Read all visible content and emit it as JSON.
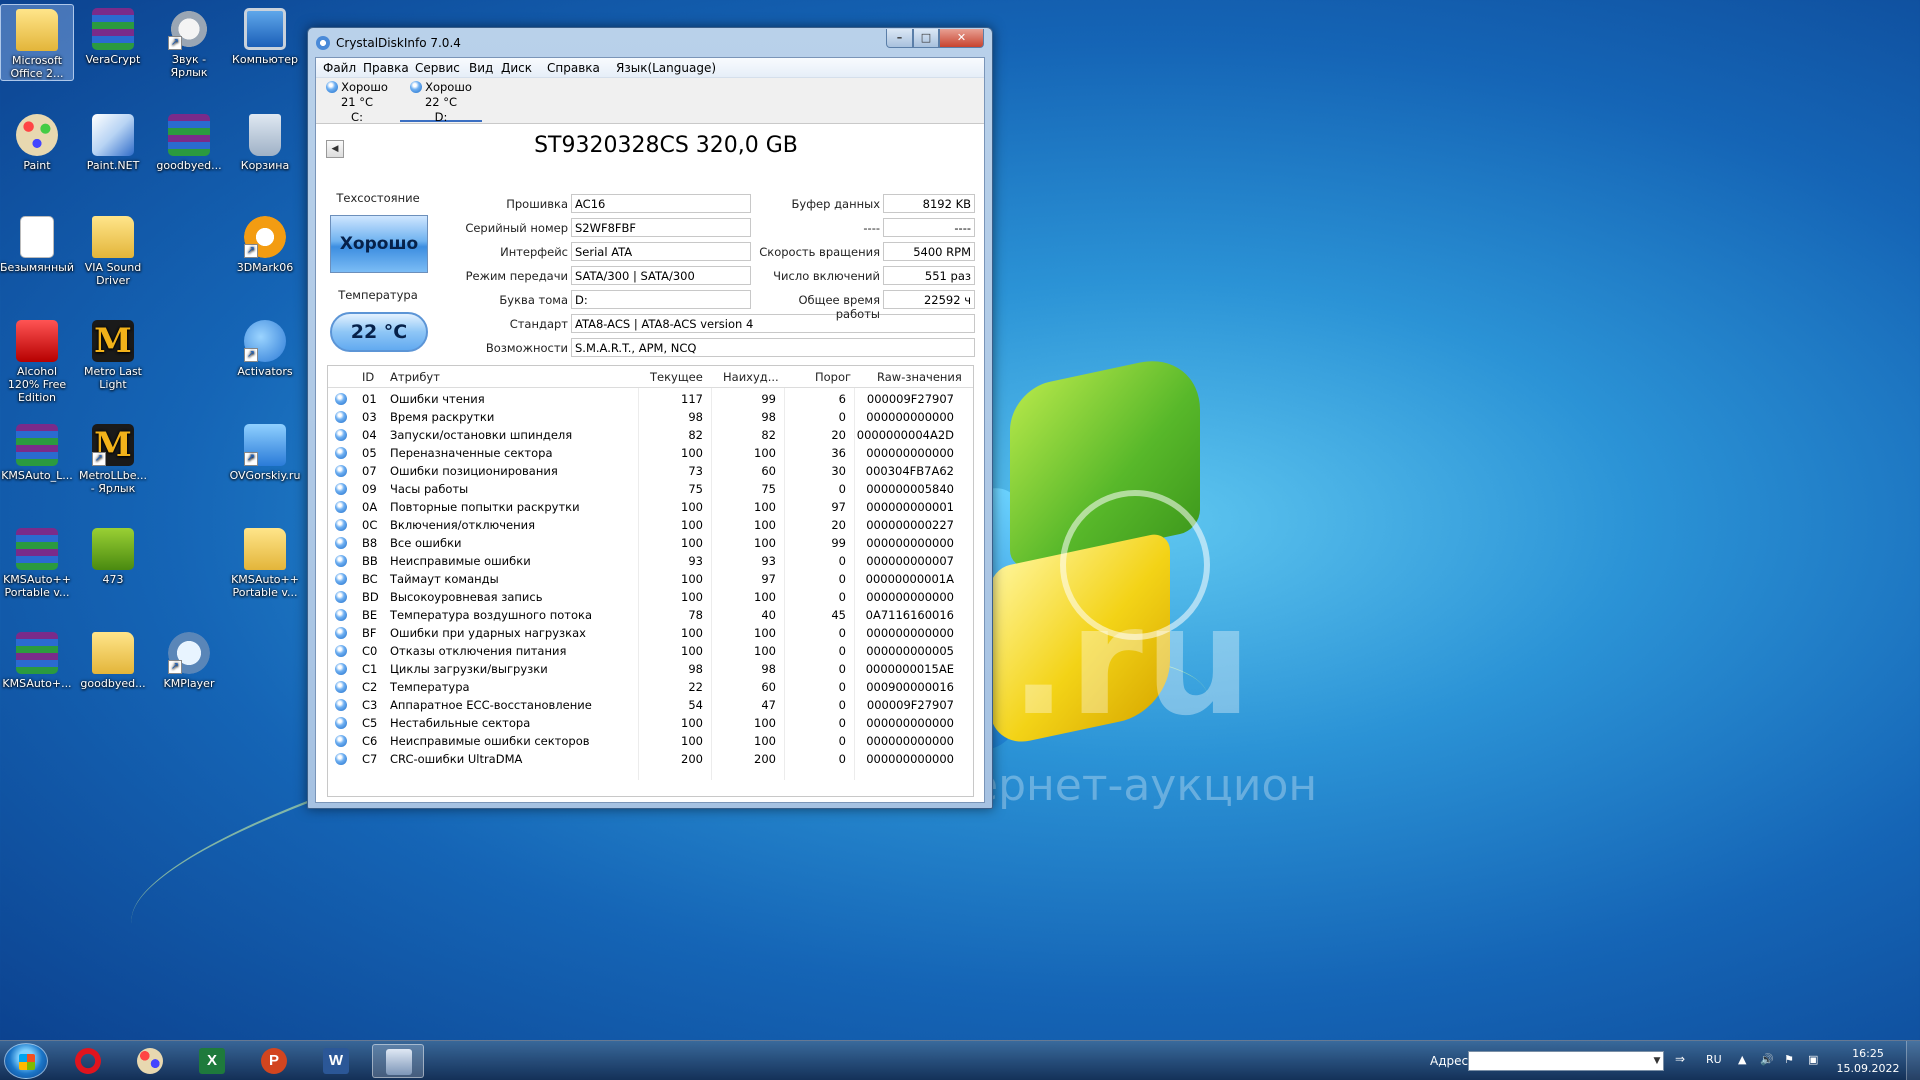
{
  "desktop": {
    "icons": [
      {
        "id": "office",
        "label": "Microsoft Office 2..."
      },
      {
        "id": "veracrypt",
        "label": "VeraCrypt"
      },
      {
        "id": "sound",
        "label": "Звук - Ярлык"
      },
      {
        "id": "computer",
        "label": "Компьютер"
      },
      {
        "id": "paint",
        "label": "Paint"
      },
      {
        "id": "paintnet",
        "label": "Paint.NET"
      },
      {
        "id": "goodbyed1",
        "label": "goodbyed..."
      },
      {
        "id": "recycle",
        "label": "Корзина"
      },
      {
        "id": "unnamed",
        "label": "Безымянный"
      },
      {
        "id": "viasound",
        "label": "VIA Sound Driver"
      },
      {
        "id": "3dmark",
        "label": "3DMark06"
      },
      {
        "id": "alcohol",
        "label": "Alcohol 120% Free Edition"
      },
      {
        "id": "metrolast",
        "label": "Metro Last Light"
      },
      {
        "id": "activators",
        "label": "Activators"
      },
      {
        "id": "kmsauto1",
        "label": "KMSAuto_L..."
      },
      {
        "id": "metrollbe",
        "label": "MetroLLbe... - Ярлык"
      },
      {
        "id": "ovgorskiy",
        "label": "OVGorskiy.ru"
      },
      {
        "id": "kmsauto2",
        "label": "KMSAuto++ Portable v..."
      },
      {
        "id": "n473",
        "label": "473"
      },
      {
        "id": "kmsauto3",
        "label": "KMSAuto++ Portable v..."
      },
      {
        "id": "kmsauto4",
        "label": "KMSAuto+..."
      },
      {
        "id": "goodbyed2",
        "label": "goodbyed..."
      },
      {
        "id": "kmplayer",
        "label": "KMPlayer"
      }
    ],
    "watermark": ".ru",
    "watermark2": "интернет-аукцион"
  },
  "window": {
    "title": "CrystalDiskInfo 7.0.4",
    "menu": [
      "Файл",
      "Правка",
      "Сервис",
      "Вид",
      "Диск",
      "Справка",
      "Язык(Language)"
    ],
    "disks": [
      {
        "status": "Хорошо",
        "temp": "21 °C",
        "letter": "C:"
      },
      {
        "status": "Хорошо",
        "temp": "22 °C",
        "letter": "D:"
      }
    ],
    "model": "ST9320328CS 320,0 GB",
    "health_label": "Техсостояние",
    "health_value": "Хорошо",
    "temp_label": "Температура",
    "temp_value": "22 °C",
    "fields": {
      "firmware_label": "Прошивка",
      "firmware": "AC16",
      "serial_label": "Серийный номер",
      "serial": "S2WF8FBF",
      "interface_label": "Интерфейс",
      "interface": "Serial ATA",
      "transfer_label": "Режим передачи",
      "transfer": "SATA/300 | SATA/300",
      "volume_label": "Буква тома",
      "volume": "D:",
      "standard_label": "Стандарт",
      "standard": "ATA8-ACS | ATA8-ACS version 4",
      "features_label": "Возможности",
      "features": "S.M.A.R.T., APM, NCQ",
      "buffer_label": "Буфер данных",
      "buffer": "8192 KB",
      "unk_label": "----",
      "unk": "----",
      "rotation_label": "Скорость вращения",
      "rotation": "5400 RPM",
      "poweron_count_label": "Число включений",
      "poweron_count": "551 раз",
      "poweron_hours_label": "Общее время работы",
      "poweron_hours": "22592 ч"
    },
    "smart_headers": {
      "id": "ID",
      "attr": "Атрибут",
      "current": "Текущее",
      "worst": "Наихуд...",
      "threshold": "Порог",
      "raw": "Raw-значения"
    },
    "smart_rows": [
      {
        "id": "01",
        "attr": "Ошибки чтения",
        "current": "117",
        "worst": "99",
        "threshold": "6",
        "raw": "000009F27907"
      },
      {
        "id": "03",
        "attr": "Время раскрутки",
        "current": "98",
        "worst": "98",
        "threshold": "0",
        "raw": "000000000000"
      },
      {
        "id": "04",
        "attr": "Запуски/остановки шпинделя",
        "current": "82",
        "worst": "82",
        "threshold": "20",
        "raw": "0000000004A2D"
      },
      {
        "id": "05",
        "attr": "Переназначенные сектора",
        "current": "100",
        "worst": "100",
        "threshold": "36",
        "raw": "000000000000"
      },
      {
        "id": "07",
        "attr": "Ошибки позиционирования",
        "current": "73",
        "worst": "60",
        "threshold": "30",
        "raw": "000304FB7A62"
      },
      {
        "id": "09",
        "attr": "Часы работы",
        "current": "75",
        "worst": "75",
        "threshold": "0",
        "raw": "000000005840"
      },
      {
        "id": "0A",
        "attr": "Повторные попытки раскрутки",
        "current": "100",
        "worst": "100",
        "threshold": "97",
        "raw": "000000000001"
      },
      {
        "id": "0C",
        "attr": "Включения/отключения",
        "current": "100",
        "worst": "100",
        "threshold": "20",
        "raw": "000000000227"
      },
      {
        "id": "B8",
        "attr": "Все ошибки",
        "current": "100",
        "worst": "100",
        "threshold": "99",
        "raw": "000000000000"
      },
      {
        "id": "BB",
        "attr": "Неисправимые ошибки",
        "current": "93",
        "worst": "93",
        "threshold": "0",
        "raw": "000000000007"
      },
      {
        "id": "BC",
        "attr": "Таймаут команды",
        "current": "100",
        "worst": "97",
        "threshold": "0",
        "raw": "00000000001A"
      },
      {
        "id": "BD",
        "attr": "Высокоуровневая запись",
        "current": "100",
        "worst": "100",
        "threshold": "0",
        "raw": "000000000000"
      },
      {
        "id": "BE",
        "attr": "Температура воздушного потока",
        "current": "78",
        "worst": "40",
        "threshold": "45",
        "raw": "0A7116160016"
      },
      {
        "id": "BF",
        "attr": "Ошибки при ударных нагрузках",
        "current": "100",
        "worst": "100",
        "threshold": "0",
        "raw": "000000000000"
      },
      {
        "id": "C0",
        "attr": "Отказы отключения питания",
        "current": "100",
        "worst": "100",
        "threshold": "0",
        "raw": "000000000005"
      },
      {
        "id": "C1",
        "attr": "Циклы загрузки/выгрузки",
        "current": "98",
        "worst": "98",
        "threshold": "0",
        "raw": "0000000015AE"
      },
      {
        "id": "C2",
        "attr": "Температура",
        "current": "22",
        "worst": "60",
        "threshold": "0",
        "raw": "000900000016"
      },
      {
        "id": "C3",
        "attr": "Аппаратное ECC-восстановление",
        "current": "54",
        "worst": "47",
        "threshold": "0",
        "raw": "000009F27907"
      },
      {
        "id": "C5",
        "attr": "Нестабильные сектора",
        "current": "100",
        "worst": "100",
        "threshold": "0",
        "raw": "000000000000"
      },
      {
        "id": "C6",
        "attr": "Неисправимые ошибки секторов",
        "current": "100",
        "worst": "100",
        "threshold": "0",
        "raw": "000000000000"
      },
      {
        "id": "C7",
        "attr": "CRC-ошибки UltraDMA",
        "current": "200",
        "worst": "200",
        "threshold": "0",
        "raw": "000000000000"
      }
    ]
  },
  "taskbar": {
    "address_label": "Адрес",
    "address_value": "",
    "lang": "RU",
    "time": "16:25",
    "date": "15.09.2022",
    "apps": [
      "opera",
      "paint",
      "excel",
      "powerpoint",
      "word",
      "crystaldiskinfo"
    ],
    "app_letters": {
      "excel": "X",
      "powerpoint": "P",
      "word": "W"
    }
  },
  "colors": {
    "accent": "#3b6fc2",
    "health_good": "#6fb2f0"
  }
}
